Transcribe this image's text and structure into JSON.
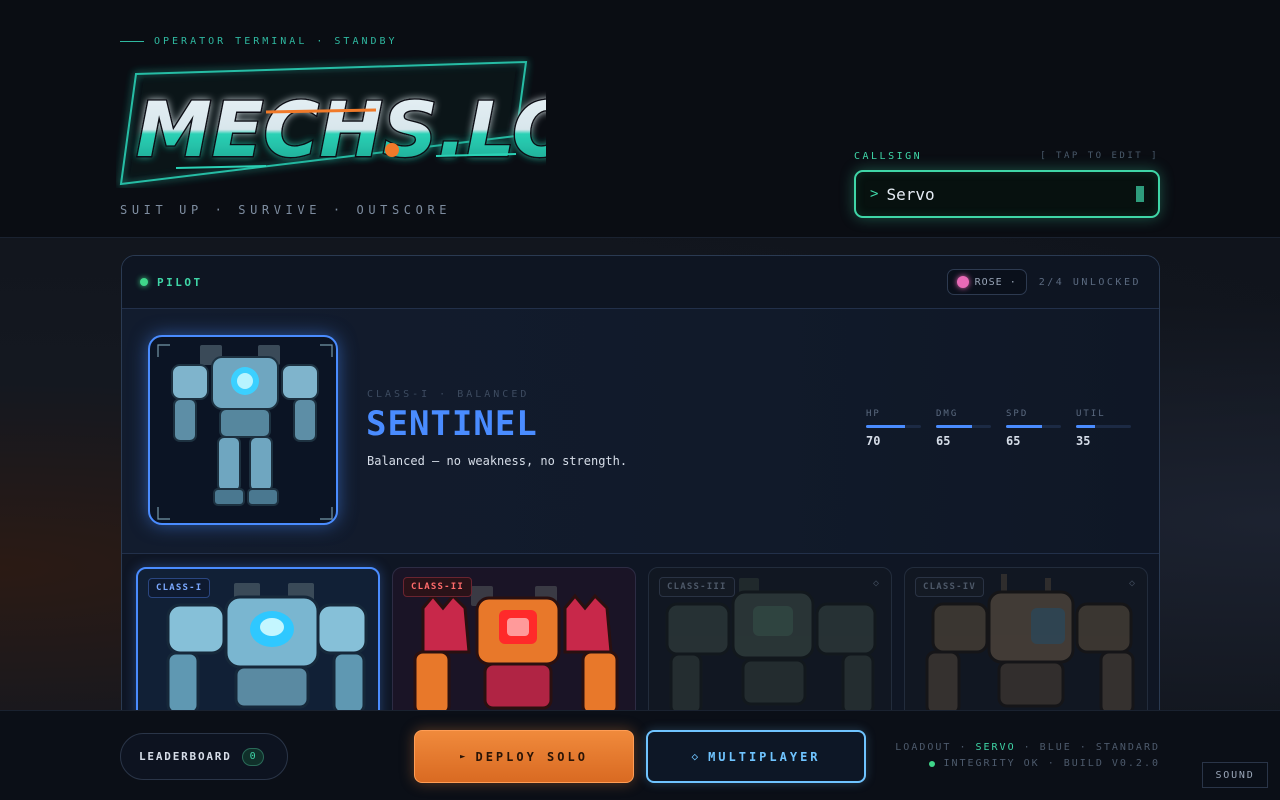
{
  "header": {
    "eyebrow": "OPERATOR TERMINAL · STANDBY",
    "logo_text": "MECHS.LOL",
    "tagline": "SUIT UP · SURVIVE · OUTSCORE",
    "callsign_label": "CALLSIGN",
    "callsign_hint": "[ TAP TO EDIT ]",
    "callsign_prompt": ">",
    "callsign_value": "Servo"
  },
  "panel": {
    "title": "PILOT",
    "skin_label": "ROSE ·",
    "skin_color": "#e86ab7",
    "unlocked": "2/4 UNLOCKED"
  },
  "selected": {
    "class_line": "CLASS-I · BALANCED",
    "name": "SENTINEL",
    "description": "Balanced — no weakness, no strength.",
    "accent": "#4a8cff",
    "stats": [
      {
        "label": "HP",
        "value": 70
      },
      {
        "label": "DMG",
        "value": 65
      },
      {
        "label": "SPD",
        "value": 65
      },
      {
        "label": "UTIL",
        "value": 35
      }
    ]
  },
  "cards": [
    {
      "tag": "CLASS-I",
      "variant": "blue",
      "locked": false,
      "selected": true
    },
    {
      "tag": "CLASS-II",
      "variant": "red",
      "locked": false,
      "selected": false
    },
    {
      "tag": "CLASS-III",
      "variant": "dim",
      "locked": true,
      "selected": false,
      "lock_glyph": "◇"
    },
    {
      "tag": "CLASS-IV",
      "variant": "dim",
      "locked": true,
      "selected": false,
      "lock_glyph": "◇"
    }
  ],
  "footer": {
    "leaderboard_label": "LEADERBOARD",
    "leaderboard_count": "0",
    "deploy_icon": "►",
    "deploy_label": "DEPLOY SOLO",
    "multi_icon": "◇",
    "multi_label": "MULTIPLAYER",
    "loadout_prefix": "LOADOUT ·",
    "loadout_name": "SERVO",
    "loadout_suffix": "· BLUE · STANDARD",
    "integrity": "INTEGRITY OK · BUILD V0.2.0",
    "sound_label": "SOUND"
  }
}
